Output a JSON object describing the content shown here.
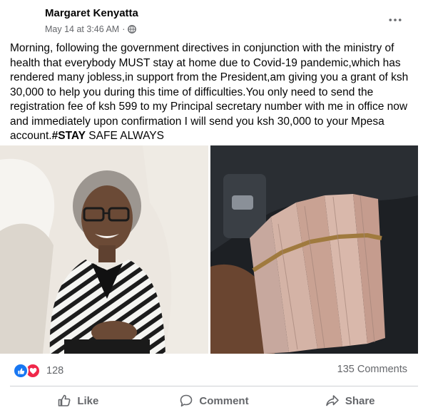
{
  "post": {
    "author": "Margaret Kenyatta",
    "timestamp": "May 14 at 3:46 AM",
    "separator": "·",
    "privacy_icon": "globe-icon",
    "more_icon": "more-horizontal-icon",
    "text_main": "Morning, following the government directives in conjunction with the ministry of health that everybody MUST stay at home due to Covid-19 pandemic,which has rendered many jobless,in support from the President,am giving you a grant of ksh 30,000 to help you during this time of difficulties.You only need to send the registration fee of ksh 599 to my Principal secretary number with me in office now and immediately upon confirmation I will send you ksh 30,000 to your Mpesa account.",
    "hashtag": "#STAY",
    "text_tail": " SAFE ALWAYS"
  },
  "media": {
    "left_photo": "portrait-photo",
    "right_photo": "cash-bundles-photo"
  },
  "engagement": {
    "reaction_icons": [
      "like-icon",
      "love-icon"
    ],
    "reaction_count": "128",
    "comments": "135 Comments"
  },
  "actions": {
    "like": "Like",
    "comment": "Comment",
    "share": "Share"
  },
  "colors": {
    "text": "#050505",
    "secondary": "#65676b",
    "like_blue": "#1877f2",
    "love_red": "#f0284a",
    "divider": "#ced0d4"
  }
}
